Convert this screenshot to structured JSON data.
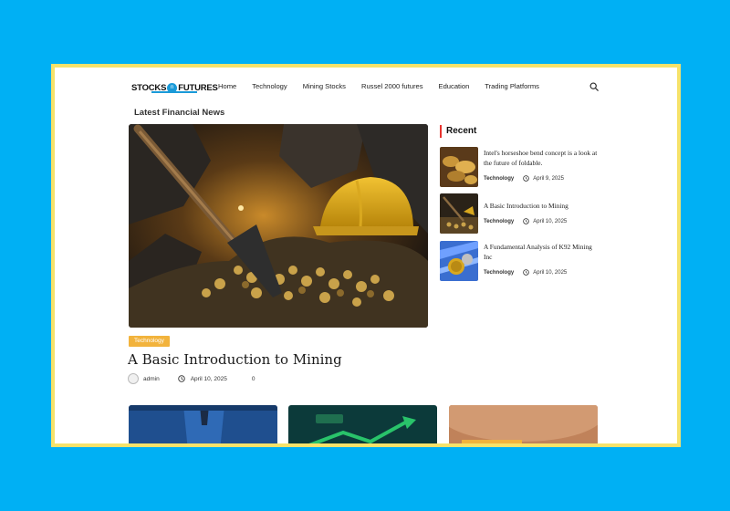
{
  "logo": {
    "left": "STOCKS",
    "badge": "n",
    "right": "FUTURES"
  },
  "nav": [
    "Home",
    "Technology",
    "Mining Stocks",
    "Russel 2000 futures",
    "Education",
    "Trading Platforms"
  ],
  "section_title": "Latest Financial News",
  "hero": {
    "category": "Technology",
    "title": "A Basic Introduction to Mining",
    "author": "admin",
    "date": "April 10, 2025",
    "comments": "0"
  },
  "recent": {
    "heading": "Recent",
    "items": [
      {
        "title": "Intel's horseshoe bend concept is a look at the future of foldable.",
        "category": "Technology",
        "date": "April 9, 2025"
      },
      {
        "title": "A Basic Introduction to Mining",
        "category": "Technology",
        "date": "April 10, 2025"
      },
      {
        "title": "A Fundamental Analysis of K92 Mining Inc",
        "category": "Technology",
        "date": "April 10, 2025"
      }
    ]
  },
  "colors": {
    "background": "#00b0f4",
    "frame": "#f6e26a",
    "accent": "#e8332e",
    "badge": "#f2b33c",
    "brand_blue": "#1a9ad8"
  }
}
